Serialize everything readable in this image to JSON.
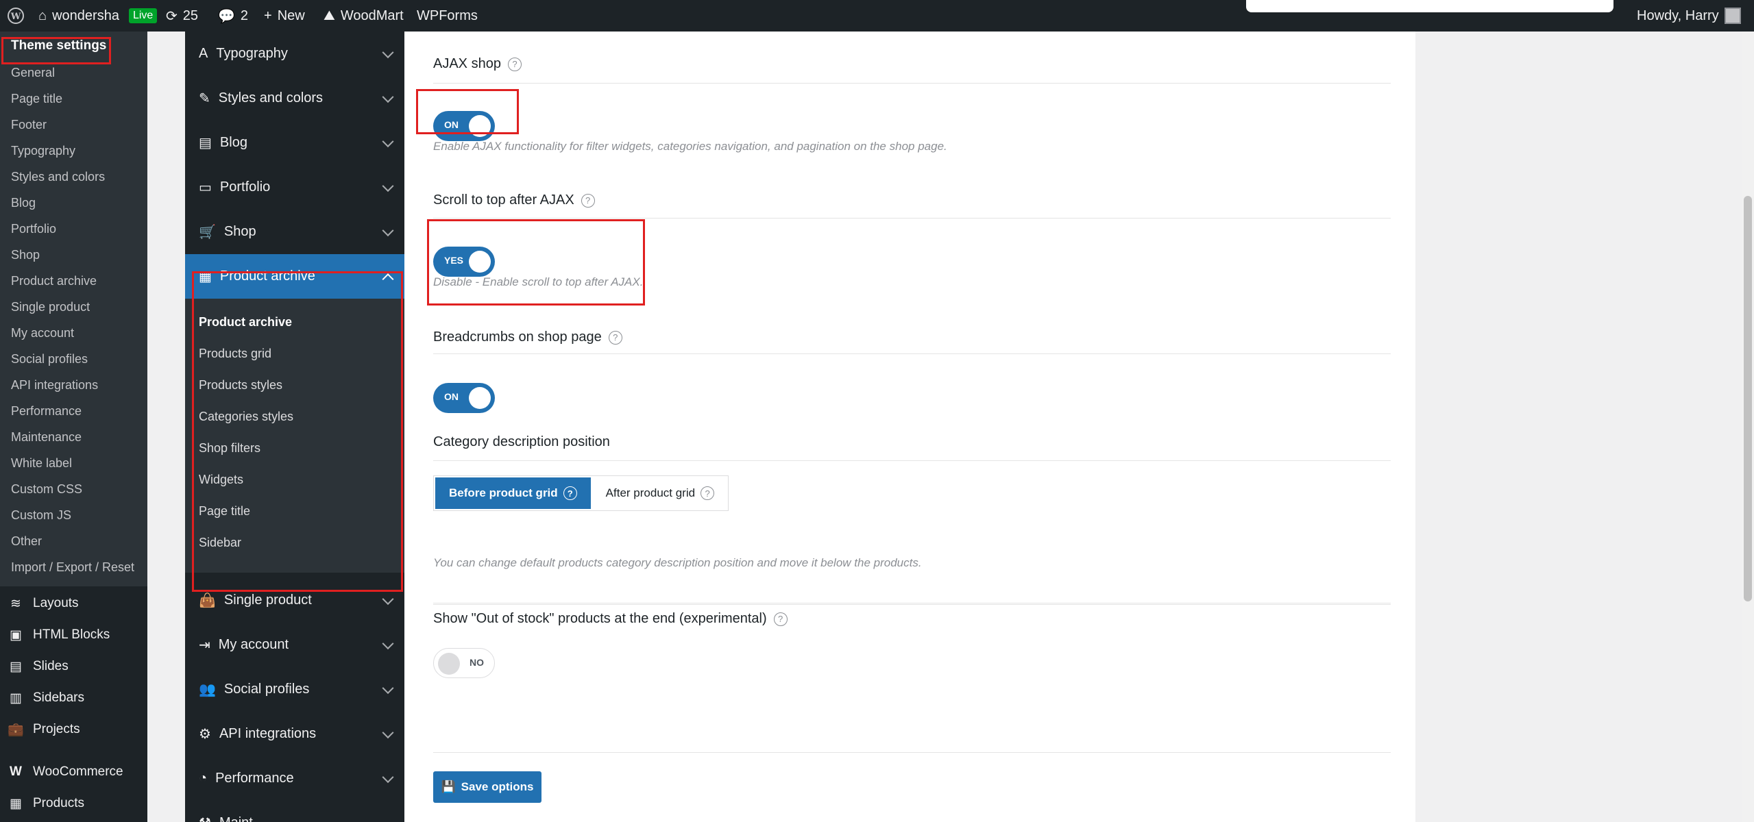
{
  "adminbar": {
    "site_name": "wondersha",
    "live_badge": "Live",
    "updates_count": "25",
    "comments_count": "2",
    "new_label": "New",
    "woodmart_label": "WoodMart",
    "wpforms_label": "WPForms",
    "howdy": "Howdy, Harry"
  },
  "wpmenu": {
    "theme_settings": "Theme settings",
    "sub_items": [
      "General",
      "Page title",
      "Footer",
      "Typography",
      "Styles and colors",
      "Blog",
      "Portfolio",
      "Shop",
      "Product archive",
      "Single product",
      "My account",
      "Social profiles",
      "API integrations",
      "Performance",
      "Maintenance",
      "White label",
      "Custom CSS",
      "Custom JS",
      "Other",
      "Import / Export / Reset"
    ],
    "main_items": [
      "Layouts",
      "HTML Blocks",
      "Slides",
      "Sidebars",
      "Projects",
      "WooCommerce",
      "Products"
    ]
  },
  "panel_nav": {
    "items_top": [
      "Typography",
      "Styles and colors",
      "Blog",
      "Portfolio",
      "Shop"
    ],
    "active": "Product archive",
    "sub_items": [
      "Product archive",
      "Products grid",
      "Products styles",
      "Categories styles",
      "Shop filters",
      "Widgets",
      "Page title",
      "Sidebar"
    ],
    "items_bottom": [
      "Single product",
      "My account",
      "Social profiles",
      "API integrations",
      "Performance",
      "Maint"
    ]
  },
  "settings": {
    "ajax_shop": {
      "title": "AJAX shop",
      "toggle": "ON",
      "desc": "Enable AJAX functionality for filter widgets, categories navigation, and pagination on the shop page."
    },
    "scroll_top": {
      "title": "Scroll to top after AJAX",
      "toggle": "YES",
      "desc": "Disable - Enable scroll to top after AJAX."
    },
    "breadcrumbs": {
      "title": "Breadcrumbs on shop page",
      "toggle": "ON"
    },
    "category_desc": {
      "title": "Category description position",
      "opt_before": "Before product grid",
      "opt_after": "After product grid",
      "desc": "You can change default products category description position and move it below the products."
    },
    "out_of_stock": {
      "title": "Show \"Out of stock\" products at the end (experimental)",
      "toggle": "NO"
    },
    "save_label": "Save options",
    "help_glyph": "?"
  },
  "colors": {
    "accent": "#2271b1",
    "highlight": "#e02020",
    "dark": "#1d2327"
  }
}
